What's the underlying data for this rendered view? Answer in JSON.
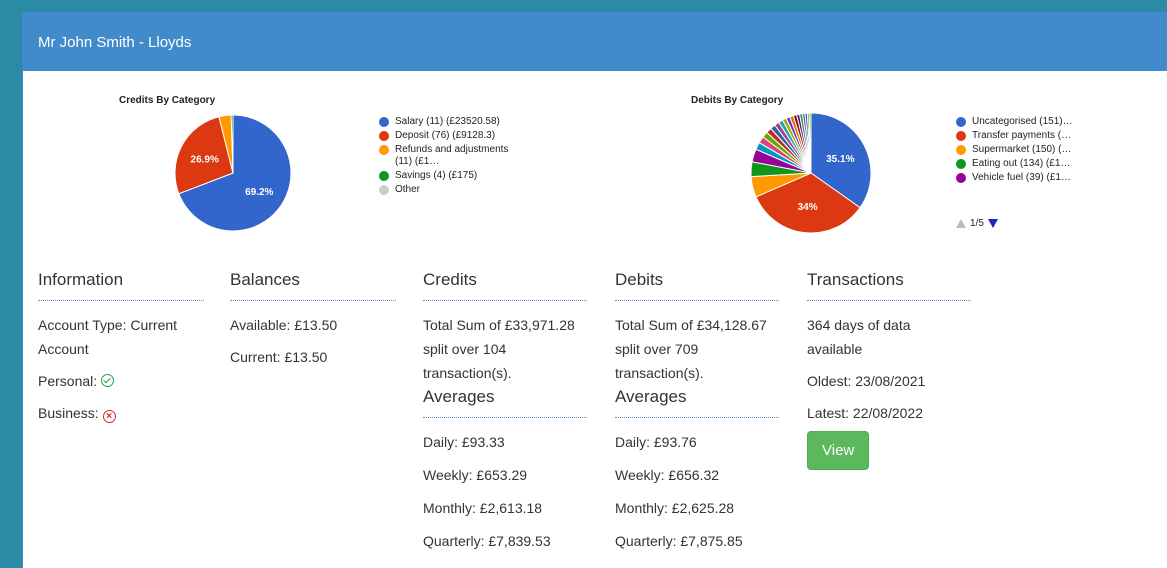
{
  "header": {
    "title": "Mr John Smith - Lloyds"
  },
  "credits_chart": {
    "title": "Credits By Category",
    "legend": [
      {
        "label": "Salary (11) (£23520.58)",
        "color": "#3366cc"
      },
      {
        "label": "Deposit (76) (£9128.3)",
        "color": "#dc3912"
      },
      {
        "label": "Refunds and adjustments (11) (£1…",
        "color": "#ff9900"
      },
      {
        "label": "Savings (4) (£175)",
        "color": "#109618"
      },
      {
        "label": "Other",
        "color": "#cccccc"
      }
    ],
    "slice_labels": [
      "69.2%",
      "26.9%"
    ]
  },
  "debits_chart": {
    "title": "Debits By Category",
    "legend": [
      {
        "label": "Uncategorised (151)…",
        "color": "#3366cc"
      },
      {
        "label": "Transfer payments (…",
        "color": "#dc3912"
      },
      {
        "label": "Supermarket (150) (…",
        "color": "#ff9900"
      },
      {
        "label": "Eating out (134) (£1…",
        "color": "#109618"
      },
      {
        "label": "Vehicle fuel (39) (£1…",
        "color": "#990099"
      }
    ],
    "slice_labels": [
      "35.1%",
      "34%"
    ],
    "pager": "1/5"
  },
  "chart_data": [
    {
      "type": "pie",
      "title": "Credits By Category",
      "categories": [
        "Salary (11) (£23520.58)",
        "Deposit (76) (£9128.3)",
        "Refunds and adjustments (11) (£1…",
        "Savings (4) (£175)",
        "Other"
      ],
      "values": [
        69.2,
        26.9,
        3.4,
        0.5,
        0.0
      ],
      "colors": [
        "#3366cc",
        "#dc3912",
        "#ff9900",
        "#109618",
        "#cccccc"
      ],
      "legend": "right"
    },
    {
      "type": "pie",
      "title": "Debits By Category",
      "categories": [
        "Uncategorised (151)…",
        "Transfer payments (…",
        "Supermarket (150) (…",
        "Eating out (134) (£1…",
        "Vehicle fuel (39) (£1…"
      ],
      "values": [
        35.1,
        34.0,
        5.6,
        4.0,
        3.5,
        2.0,
        1.8,
        1.6,
        1.5,
        1.4,
        1.3,
        1.2,
        1.1,
        1.0,
        1.0,
        0.9,
        0.8,
        0.8,
        0.7,
        0.6,
        0.5,
        0.5
      ],
      "colors": [
        "#3366cc",
        "#dc3912",
        "#ff9900",
        "#109618",
        "#990099",
        "#0099c6",
        "#dd4477",
        "#66aa00",
        "#b82e2e",
        "#316395",
        "#994499",
        "#22aa99",
        "#aaaa11",
        "#6633cc",
        "#e67300",
        "#8b0707",
        "#651067",
        "#329262",
        "#5574a6",
        "#3b3eac",
        "#b77322",
        "#16d620"
      ],
      "legend": "right"
    }
  ],
  "information": {
    "title": "Information",
    "account_type_line1": "Account Type: Current",
    "account_type_line2": "Account",
    "personal": "Personal:",
    "business": "Business:"
  },
  "balances": {
    "title": "Balances",
    "available": "Available: £13.50",
    "current": "Current: £13.50"
  },
  "credits": {
    "title": "Credits",
    "line1": "Total Sum of £33,971.28",
    "line2": "split over 104",
    "line3": "transaction(s).",
    "averages_title": "Averages",
    "daily": "Daily: £93.33",
    "weekly": "Weekly: £653.29",
    "monthly": "Monthly: £2,613.18",
    "quarterly": "Quarterly: £7,839.53"
  },
  "debits": {
    "title": "Debits",
    "line1": "Total Sum of £34,128.67",
    "line2": "split over 709",
    "line3": "transaction(s).",
    "averages_title": "Averages",
    "daily": "Daily: £93.76",
    "weekly": "Weekly: £656.32",
    "monthly": "Monthly: £2,625.28",
    "quarterly": "Quarterly: £7,875.85"
  },
  "transactions": {
    "title": "Transactions",
    "line1": "364 days of data",
    "line2": "available",
    "oldest": "Oldest: 23/08/2021",
    "latest": "Latest: 22/08/2022",
    "view_label": "View"
  }
}
